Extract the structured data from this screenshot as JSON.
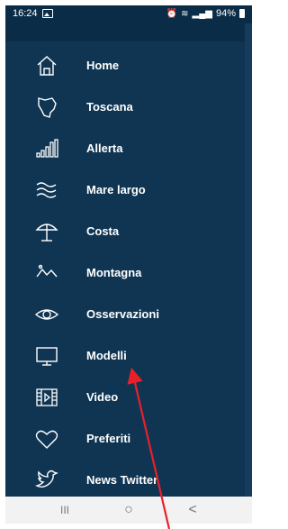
{
  "status_bar": {
    "time": "16:24",
    "battery": "94%"
  },
  "menu": {
    "items": [
      {
        "label": "Home",
        "icon": "home-icon"
      },
      {
        "label": "Toscana",
        "icon": "tuscany-map-icon"
      },
      {
        "label": "Allerta",
        "icon": "signal-bars-icon"
      },
      {
        "label": "Mare largo",
        "icon": "waves-icon"
      },
      {
        "label": "Costa",
        "icon": "beach-umbrella-icon"
      },
      {
        "label": "Montagna",
        "icon": "mountain-icon"
      },
      {
        "label": "Osservazioni",
        "icon": "eye-icon"
      },
      {
        "label": "Modelli",
        "icon": "monitor-icon"
      },
      {
        "label": "Video",
        "icon": "film-icon"
      },
      {
        "label": "Preferiti",
        "icon": "heart-icon"
      },
      {
        "label": "News Twitter",
        "icon": "twitter-bird-icon"
      }
    ]
  },
  "nav_bar": {
    "recent_glyph": "III",
    "home_glyph": "○",
    "back_glyph": "<"
  },
  "colors": {
    "drawer_background": "#0f3553",
    "status_background": "#0b2c47",
    "annotation_arrow": "#e8202a"
  }
}
